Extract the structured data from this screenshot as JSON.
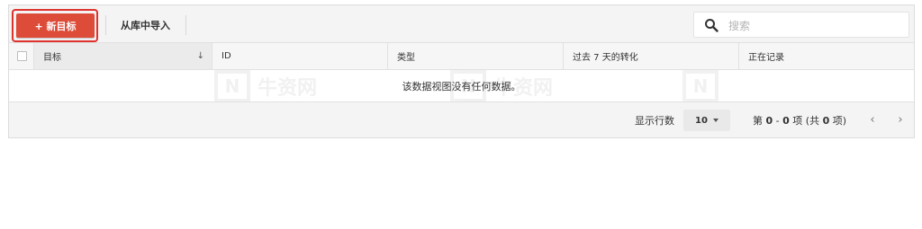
{
  "toolbar": {
    "new_goal_label": "+ 新目标",
    "import_label": "从库中导入",
    "search_placeholder": "搜索"
  },
  "table": {
    "columns": [
      "目标",
      "ID",
      "类型",
      "过去 7 天的转化",
      "正在记录"
    ],
    "sorted_column": "目标",
    "empty_message": "该数据视图没有任何数据。"
  },
  "footer": {
    "rows_label": "显示行数",
    "rows_value": "10",
    "range_prefix": "第",
    "range_start": "0",
    "range_sep": " - ",
    "range_end": "0",
    "range_mid": " 项 (共",
    "range_total": "0",
    "range_suffix": " 项)"
  },
  "watermark": {
    "letter": "N",
    "text": "牛资网"
  },
  "colors": {
    "new_button": "#dd4b39",
    "highlight_border": "#e0322d"
  },
  "icons": {
    "search": "search-icon",
    "sort": "sort-down-icon",
    "prev": "chevron-left-icon",
    "next": "chevron-right-icon"
  }
}
